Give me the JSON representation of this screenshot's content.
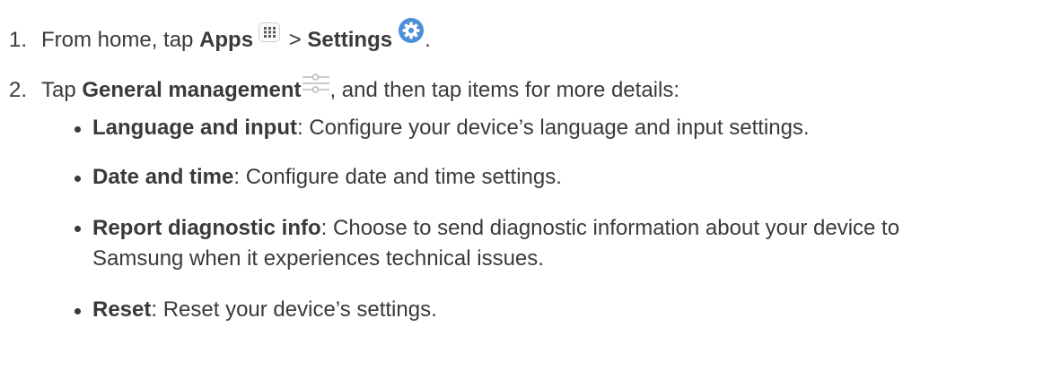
{
  "steps": [
    {
      "number": "1.",
      "prefix": "From home, tap ",
      "bold1": "Apps",
      "separator": " > ",
      "bold2": "Settings",
      "suffix": "."
    },
    {
      "number": "2.",
      "prefix": "Tap ",
      "bold": "General management",
      "suffix": ", and then tap items for more details:"
    }
  ],
  "items": [
    {
      "title": "Language and input",
      "text": ": Configure your device’s language and input settings."
    },
    {
      "title": "Date and time",
      "text": ": Configure date and time settings."
    },
    {
      "title": "Report diagnostic info",
      "text": ": Choose to send diagnostic information about your device to",
      "text_line2": "Samsung when it experiences technical issues."
    },
    {
      "title": "Reset",
      "text": ": Reset your device’s settings."
    }
  ],
  "icons": {
    "apps": "apps-grid-icon",
    "settings": "settings-gear-icon",
    "general_management": "sliders-icon"
  },
  "colors": {
    "text": "#3a3a3a",
    "settings_icon_blue": "#4a90d9"
  }
}
